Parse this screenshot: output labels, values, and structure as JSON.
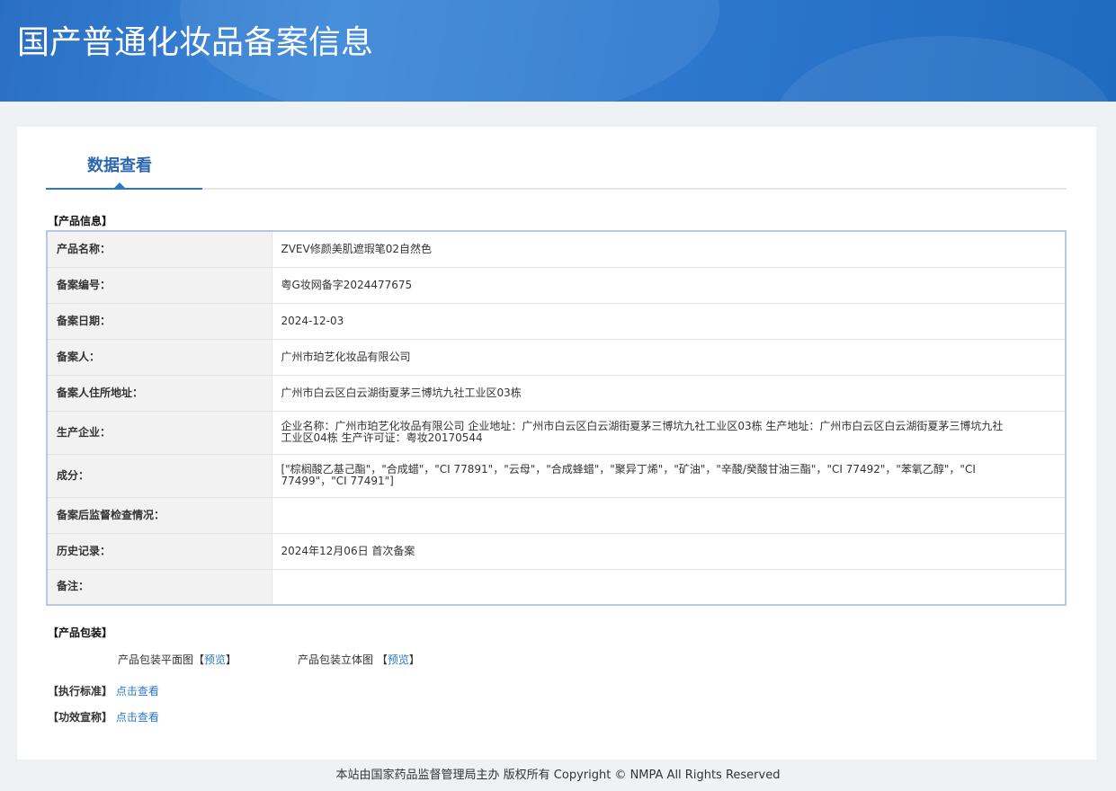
{
  "header": {
    "title": "国产普通化妆品备案信息"
  },
  "tab": {
    "label": "数据查看"
  },
  "product_info": {
    "section_title": "【产品信息】",
    "rows": [
      {
        "label": "产品名称：",
        "value": "ZVEV修颜美肌遮瑕笔02自然色"
      },
      {
        "label": "备案编号：",
        "value": "粤G妆网备字2024477675"
      },
      {
        "label": "备案日期：",
        "value": "2024-12-03"
      },
      {
        "label": "备案人：",
        "value": "广州市珀艺化妆品有限公司"
      },
      {
        "label": "备案人住所地址：",
        "value": "广州市白云区白云湖街夏茅三博坑九社工业区03栋"
      },
      {
        "label": "生产企业：",
        "value": "企业名称：广州市珀艺化妆品有限公司 企业地址：广州市白云区白云湖街夏茅三博坑九社工业区03栋 生产地址：广州市白云区白云湖街夏茅三博坑九社工业区04栋 生产许可证：粤妆20170544"
      },
      {
        "label": "成分：",
        "value": "[\"棕榈酸乙基己酯\"，\"合成蜡\"，\"CI 77891\"，\"云母\"，\"合成蜂蜡\"，\"聚异丁烯\"，\"矿油\"，\"辛酸/癸酸甘油三酯\"，\"CI 77492\"，\"苯氧乙醇\"，\"CI 77499\"，\"CI 77491\"]"
      },
      {
        "label": "备案后监督检查情况：",
        "value": ""
      },
      {
        "label": "历史记录：",
        "value": "2024年12月06日 首次备案"
      },
      {
        "label": "备注：",
        "value": ""
      }
    ]
  },
  "packaging": {
    "section_title": "【产品包装】",
    "flat_label": "产品包装平面图【",
    "flat_link": "预览",
    "flat_close": "】",
    "solid_label": "产品包装立体图 【",
    "solid_link": "预览",
    "solid_close": "】"
  },
  "standard": {
    "label": "【执行标准】",
    "link": "点击查看"
  },
  "efficacy": {
    "label": "【功效宣称】",
    "link": "点击查看"
  },
  "footer": {
    "text": "本站由国家药品监督管理局主办 版权所有 Copyright © NMPA All Rights Reserved"
  }
}
